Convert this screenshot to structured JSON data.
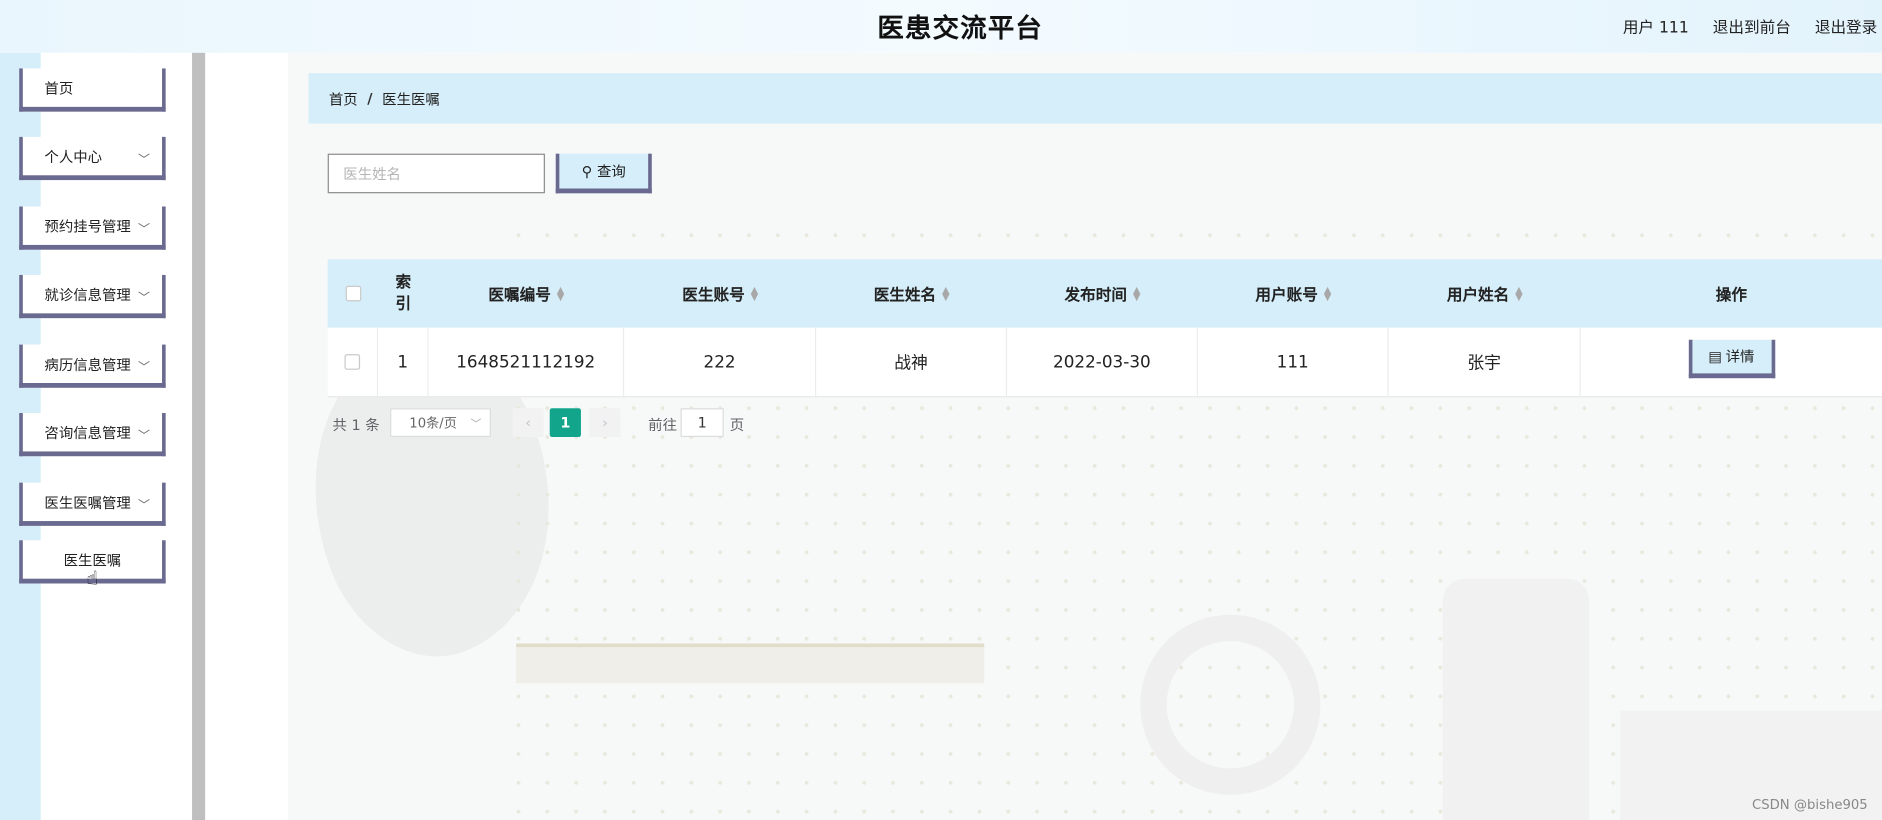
{
  "header": {
    "app_title": "医患交流平台",
    "user_label": "用户 111",
    "back_to_front": "退出到前台",
    "logout": "退出登录"
  },
  "sidebar": {
    "items": [
      {
        "label": "首页"
      },
      {
        "label": "个人中心"
      },
      {
        "label": "预约挂号管理"
      },
      {
        "label": "就诊信息管理"
      },
      {
        "label": "病历信息管理"
      },
      {
        "label": "咨询信息管理"
      },
      {
        "label": "医生医嘱管理"
      }
    ],
    "sub_item": "医生医嘱"
  },
  "breadcrumb": {
    "home": "首页",
    "separator": "/",
    "current": "医生医嘱"
  },
  "search": {
    "placeholder": "医生姓名",
    "button_label": "查询"
  },
  "table": {
    "headers": {
      "index": "索\n引",
      "order_no": "医嘱编号",
      "doctor_account": "医生账号",
      "doctor_name": "医生姓名",
      "publish_time": "发布时间",
      "user_account": "用户账号",
      "user_name": "用户姓名",
      "action": "操作"
    },
    "rows": [
      {
        "index": "1",
        "order_no": "1648521112192",
        "doctor_account": "222",
        "doctor_name": "战神",
        "publish_time": "2022-03-30",
        "user_account": "111",
        "user_name": "张宇",
        "action_label": "详情"
      }
    ]
  },
  "pagination": {
    "total": "共 1 条",
    "page_size": "10条/页",
    "current_page": "1",
    "goto_label": "前往",
    "goto_value": "1",
    "page_suffix": "页"
  },
  "watermark": "CSDN @bishe905",
  "colors": {
    "accent_light_blue": "#d6eef9",
    "border_purple": "#6a6a90",
    "pager_active": "#12a58c"
  }
}
